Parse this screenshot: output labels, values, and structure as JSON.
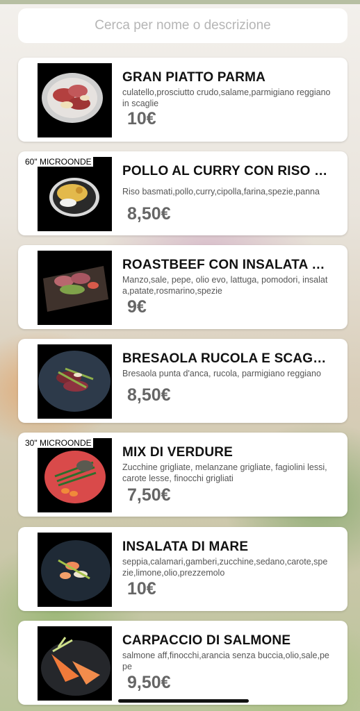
{
  "search": {
    "placeholder": "Cerca per nome o descrizione"
  },
  "items": [
    {
      "title": "GRAN PIATTO PARMA",
      "desc": "culatello,prosciutto crudo,salame,parmigiano reggiano in scaglie",
      "price": "10€",
      "badge": ""
    },
    {
      "title": "POLLO AL CURRY CON RISO B...",
      "desc": "Riso basmati,pollo,curry,cipolla,farina,spezie,panna",
      "price": "8,50€",
      "badge": "60\" MICROONDE"
    },
    {
      "title": "ROASTBEEF CON INSALATA E...",
      "desc": "Manzo,sale, pepe, olio evo, lattuga, pomodori, insalata,patate,rosmarino,spezie",
      "price": "9€",
      "badge": ""
    },
    {
      "title": "BRESAOLA RUCOLA E SCAGLIE",
      "desc": "Bresaola punta d'anca, rucola, parmigiano reggiano",
      "price": "8,50€",
      "badge": ""
    },
    {
      "title": "MIX DI VERDURE",
      "desc": "Zucchine grigliate, melanzane grigliate, fagiolini lessi, carote lesse, finocchi grigliati",
      "price": "7,50€",
      "badge": "30\" MICROONDE"
    },
    {
      "title": "INSALATA DI MARE",
      "desc": "seppia,calamari,gamberi,zucchine,sedano,carote,spezie,limone,olio,prezzemolo",
      "price": "10€",
      "badge": ""
    },
    {
      "title": "CARPACCIO DI SALMONE",
      "desc": "salmone aff,finocchi,arancia senza buccia,olio,sale,pepe",
      "price": "9,50€",
      "badge": ""
    }
  ]
}
